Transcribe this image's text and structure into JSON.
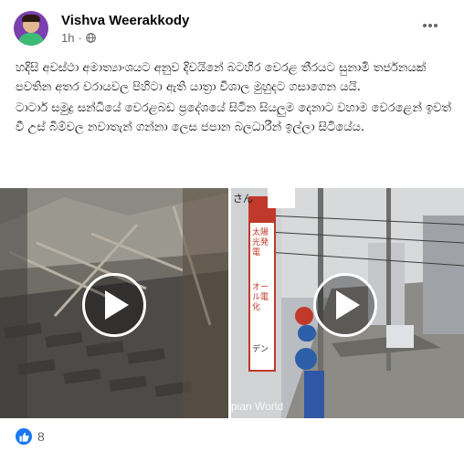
{
  "post": {
    "author": "Vishva Weerakkody",
    "time": "1h",
    "privacy_icon": "globe-icon",
    "more_icon": "more-options-icon",
    "paragraphs": [
      "හදිසි අවස්ථා අමාත්‍යාංශයට අනුව දිවයිනේ බටහිර වෙරළ තීරයට සුනාමි තර්ජනයක් පවතින අතර  වරායවල පිහිටා ඇති යාත්‍රා විශාල මුහුදට ගසාගෙන යයි.",
      "ටාටාර් සමුද්‍ර සන්ධියේ වෙරළබඩ ප්‍රදේශයේ සිටින සියලුම දෙනාට වහාම වෙරළෙන් ඉවත් වී උස් බිම්වල නවාතැන් ගන්නා ලෙස  ජපාන බලධාරීන්  ඉල්ලා සිටියේය."
    ]
  },
  "media": {
    "videos": [
      {
        "name": "collapsed-house-video",
        "play_icon": "play-icon"
      },
      {
        "name": "tsunami-street-video",
        "play_icon": "play-icon",
        "sign_1": "太陽光発電",
        "sign_2": "オール電化",
        "sign_3": "デン",
        "sign_4": "さん",
        "watermark": "pian World"
      }
    ]
  },
  "reactions": {
    "icon": "thumbs-up-icon",
    "count": "8",
    "color": "#1877f2"
  }
}
